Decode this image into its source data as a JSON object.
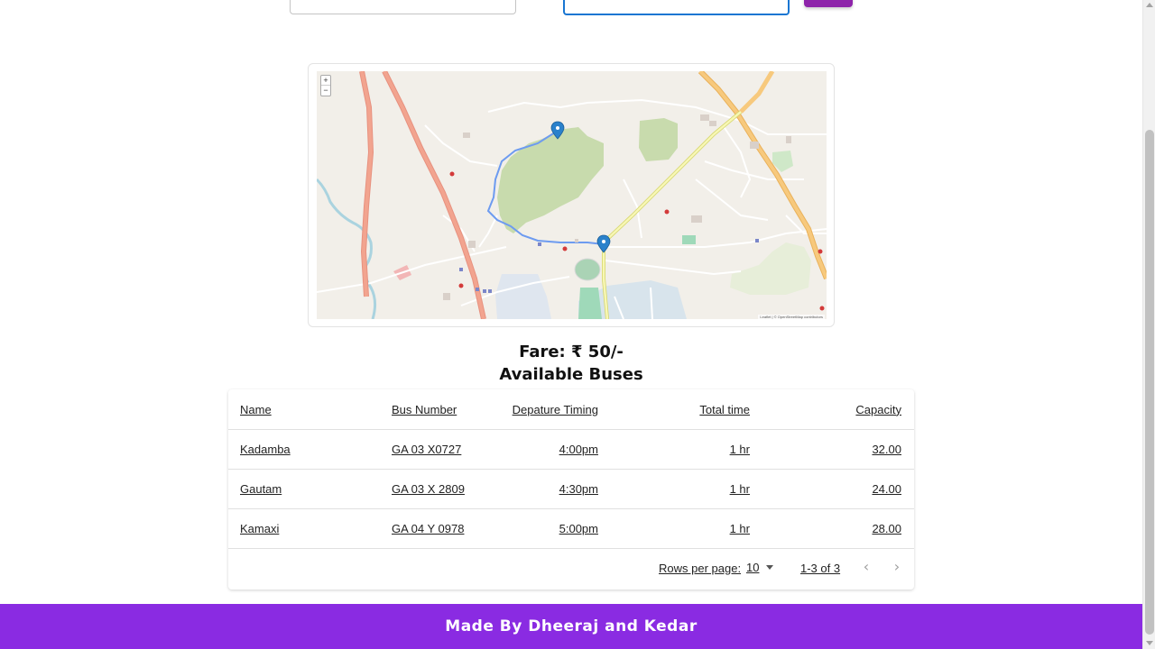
{
  "fare": {
    "text": "Fare: ₹ 50/-"
  },
  "buses": {
    "heading": "Available Buses",
    "columns": {
      "name": "Name",
      "bus_number": "Bus Number",
      "departure": "Depature Timing",
      "total_time": "Total time",
      "capacity": "Capacity"
    },
    "rows": [
      {
        "name": "Kadamba",
        "bus_number": "GA 03 X0727",
        "departure": "4:00pm",
        "total_time": "1 hr",
        "capacity": "32.00"
      },
      {
        "name": "Gautam",
        "bus_number": "GA 03 X 2809",
        "departure": "4:30pm",
        "total_time": "1 hr",
        "capacity": "24.00"
      },
      {
        "name": "Kamaxi",
        "bus_number": "GA 04 Y 0978",
        "departure": "5:00pm",
        "total_time": "1 hr",
        "capacity": "28.00"
      }
    ],
    "pagination": {
      "rows_per_page_label": "Rows per page:",
      "rows_per_page_value": "10",
      "range": "1-3 of 3"
    }
  },
  "map": {
    "zoom_in": "+",
    "zoom_out": "−",
    "attribution": "Leaflet | © OpenStreetMap contributors",
    "markers": [
      "map-marker-icon",
      "map-marker-icon"
    ]
  },
  "footer": {
    "text": "Made By Dheeraj and Kedar"
  },
  "colors": {
    "accent": "#8a2be2",
    "button": "#8e24aa",
    "focus": "#1976d2",
    "route": "#6d9bf0"
  }
}
